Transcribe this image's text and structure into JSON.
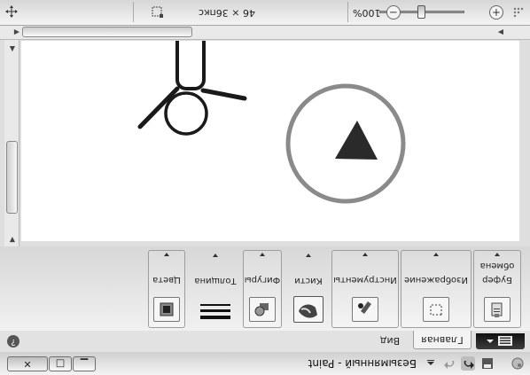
{
  "window": {
    "title": "Безымянный - Paint",
    "minimize_glyph": "▁",
    "maximize_glyph": "□",
    "close_glyph": "✕"
  },
  "quick_access": [
    "save-icon",
    "undo-icon",
    "redo-icon",
    "customize-icon"
  ],
  "ribbon_tabs": {
    "home": "Главная",
    "view": "Вид"
  },
  "ribbon": {
    "groups": [
      {
        "id": "clipboard",
        "label": "Буфер",
        "sublabel": "обмена",
        "icon": "clipboard-icon"
      },
      {
        "id": "image",
        "label": "Изображение",
        "icon": "select-icon"
      },
      {
        "id": "tools",
        "label": "Инструменты",
        "icon": "tools-icon"
      },
      {
        "id": "brushes",
        "label": "Кисти",
        "icon": "brush-icon"
      },
      {
        "id": "shapes",
        "label": "Фигуры",
        "icon": "shapes-icon"
      },
      {
        "id": "size",
        "label": "Толщина",
        "icon": "line-thickness-icon"
      },
      {
        "id": "colors",
        "label": "Цвета",
        "icon": "color-picker-icon"
      }
    ]
  },
  "status": {
    "zoom_level": "100%",
    "zoom_fraction": 0.5,
    "zoom_out_glyph": "−",
    "zoom_in_glyph": "+",
    "canvas_size": "46 × 36пкс"
  },
  "colors": {
    "stroke": "#1a1a1a",
    "shape_outline": "#8a8a8a",
    "triangle_fill": "#2a2a2a"
  }
}
